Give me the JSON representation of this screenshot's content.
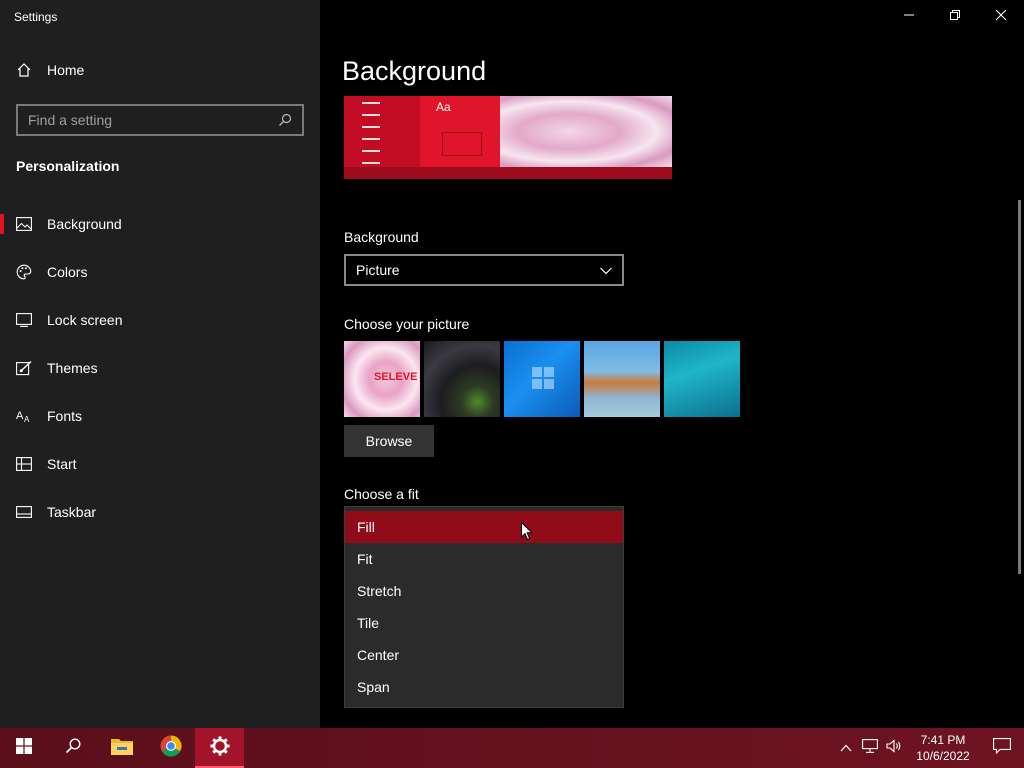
{
  "window": {
    "title": "Settings",
    "minimize_icon": "minimize-icon",
    "restore_icon": "restore-icon",
    "close_icon": "close-icon"
  },
  "sidebar": {
    "home_label": "Home",
    "search_placeholder": "Find a setting",
    "section": "Personalization",
    "items": [
      {
        "label": "Background",
        "icon": "picture-icon",
        "active": true
      },
      {
        "label": "Colors",
        "icon": "palette-icon"
      },
      {
        "label": "Lock screen",
        "icon": "lock-screen-icon"
      },
      {
        "label": "Themes",
        "icon": "brush-icon"
      },
      {
        "label": "Fonts",
        "icon": "font-icon"
      },
      {
        "label": "Start",
        "icon": "start-icon"
      },
      {
        "label": "Taskbar",
        "icon": "taskbar-icon"
      }
    ]
  },
  "main": {
    "title": "Background",
    "preview": {
      "aa_text": "Aa"
    },
    "background_label": "Background",
    "background_value": "Picture",
    "choose_picture_label": "Choose your picture",
    "browse_label": "Browse",
    "choose_fit_label": "Choose a fit",
    "fit_options": [
      "Fill",
      "Fit",
      "Stretch",
      "Tile",
      "Center",
      "Span"
    ],
    "fit_selected": "Fill"
  },
  "taskbar": {
    "time": "7:41 PM",
    "date": "10/6/2022",
    "apps": [
      "start-icon",
      "search-icon",
      "file-explorer-icon",
      "chrome-icon",
      "settings-gear-icon"
    ],
    "colors": {
      "accent": "#a3142a",
      "highlight": "#8f0c18",
      "active_bar": "#e81123"
    }
  }
}
